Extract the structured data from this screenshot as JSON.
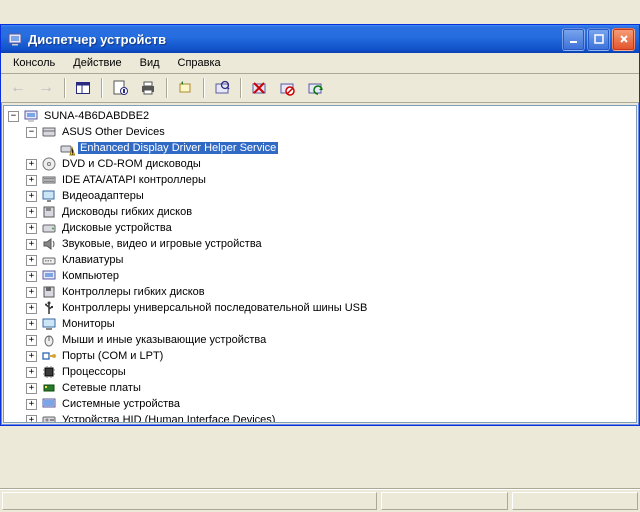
{
  "window": {
    "title": "Диспетчер устройств"
  },
  "menu": {
    "items": [
      "Консоль",
      "Действие",
      "Вид",
      "Справка"
    ]
  },
  "tree": {
    "root": "SUNA-4B6DABDBE2",
    "asus_group": "ASUS Other Devices",
    "selected": "Enhanced Display Driver Helper Service",
    "items": [
      "DVD и CD-ROM дисководы",
      "IDE ATA/ATAPI контроллеры",
      "Видеоадаптеры",
      "Дисководы гибких дисков",
      "Дисковые устройства",
      "Звуковые, видео и игровые устройства",
      "Клавиатуры",
      "Компьютер",
      "Контроллеры гибких дисков",
      "Контроллеры универсальной последовательной шины USB",
      "Мониторы",
      "Мыши и иные указывающие устройства",
      "Порты (COM и LPT)",
      "Процессоры",
      "Сетевые платы",
      "Системные устройства",
      "Устройства HID (Human Interface Devices)"
    ]
  }
}
